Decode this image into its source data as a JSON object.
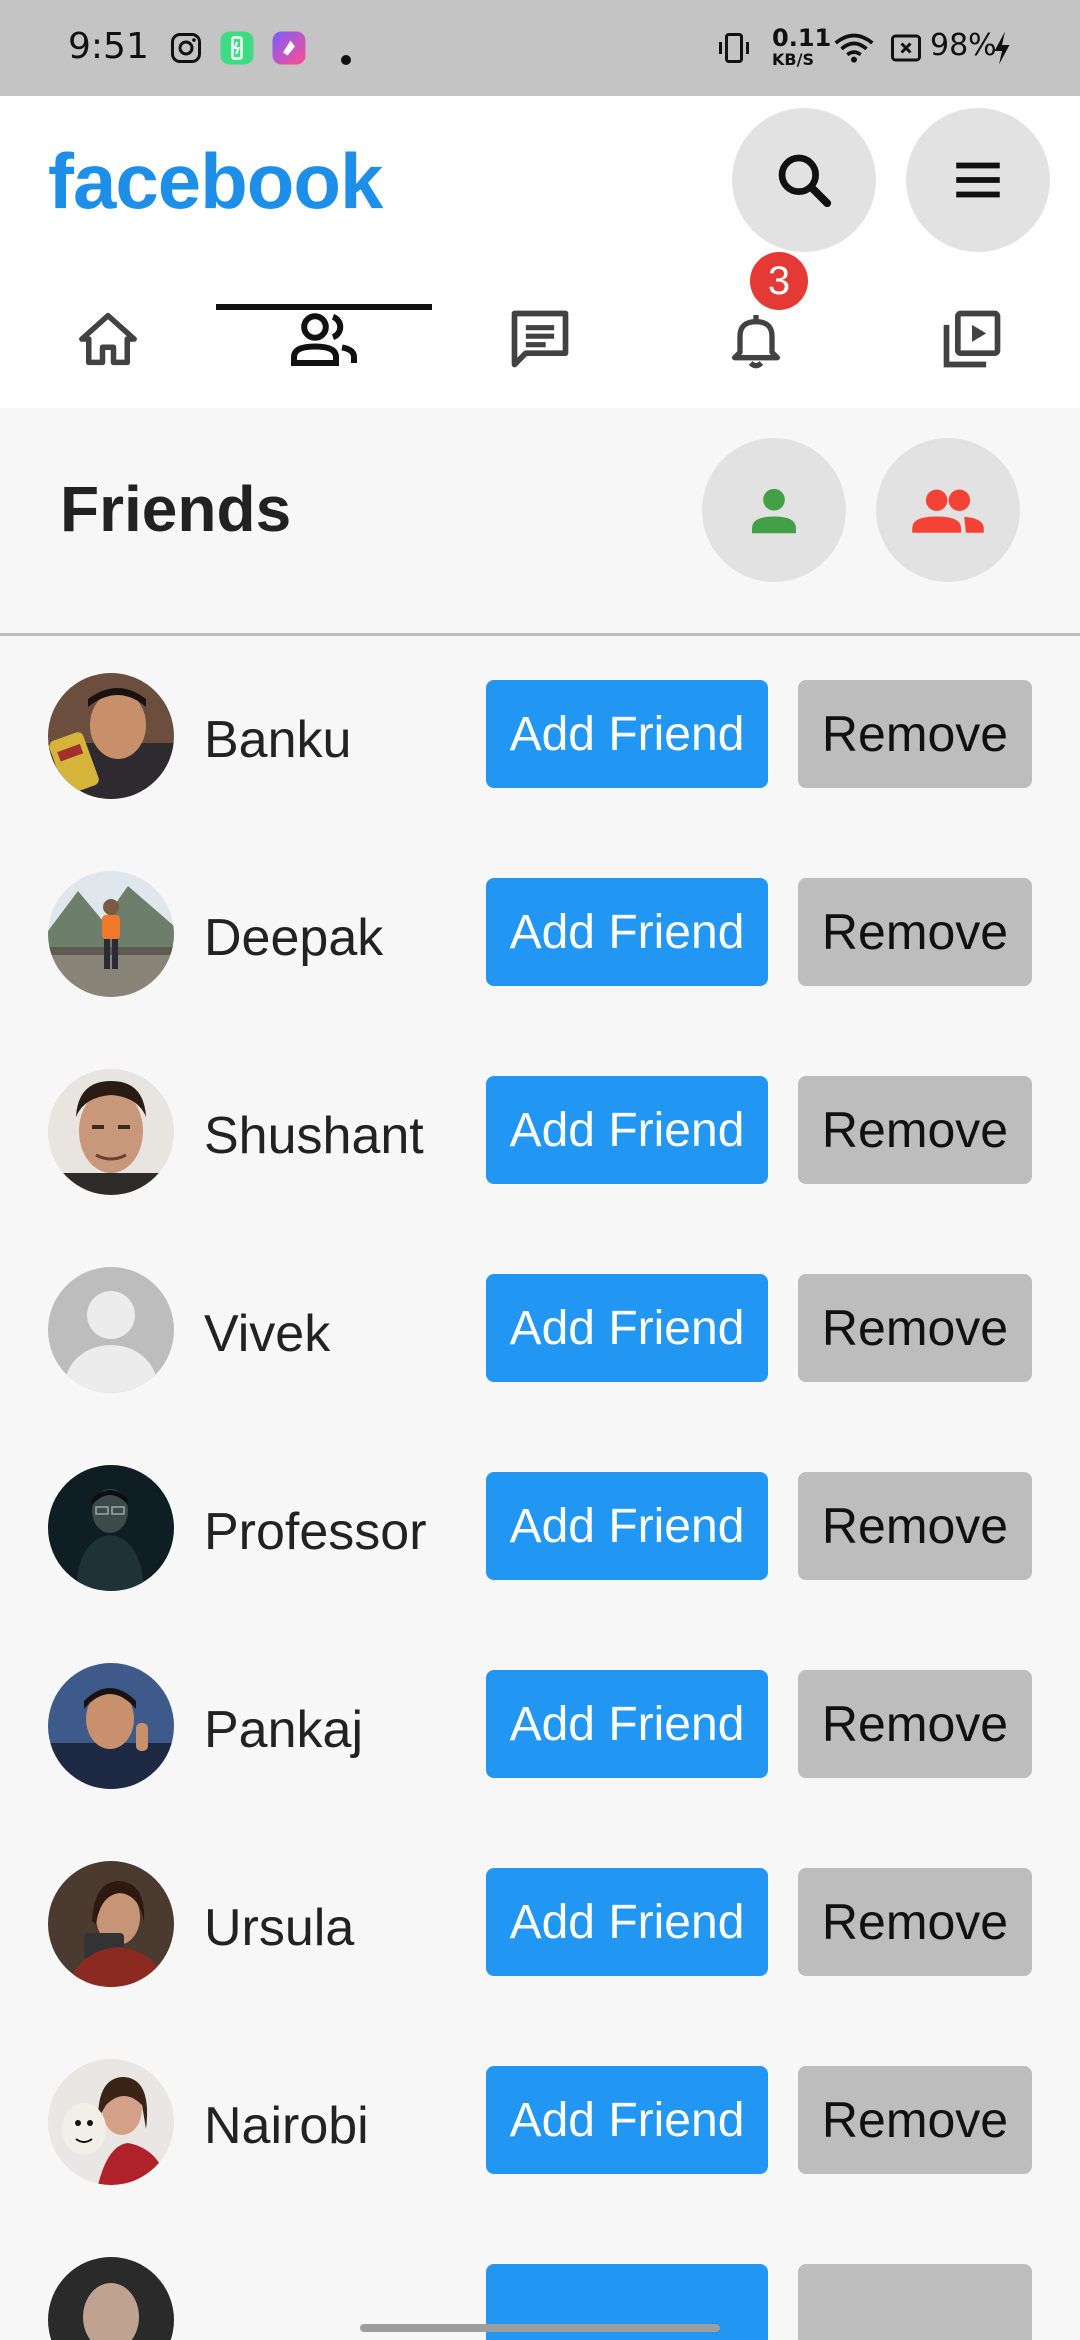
{
  "status_bar": {
    "time": "9:51",
    "speed_value": "0.11",
    "speed_unit": "KB/S",
    "battery": "98%",
    "icons": [
      "instagram-icon",
      "battery-saver-icon",
      "shortcut-icon",
      "dot-icon",
      "vibrate-icon",
      "wifi-icon",
      "sim-blocked-icon",
      "charging-icon"
    ]
  },
  "header": {
    "brand": "facebook",
    "brand_color": "#1e8fe8",
    "actions": [
      "search-icon",
      "menu-icon"
    ]
  },
  "tabs": [
    {
      "icon": "home-icon",
      "active": false
    },
    {
      "icon": "friends-icon",
      "active": true
    },
    {
      "icon": "messages-icon",
      "active": false
    },
    {
      "icon": "bell-icon",
      "active": false,
      "badge": "3"
    },
    {
      "icon": "video-icon",
      "active": false
    }
  ],
  "friends": {
    "title": "Friends",
    "actions": [
      {
        "icon": "person-icon",
        "color": "#43a047"
      },
      {
        "icon": "group-icon",
        "color": "#f44336"
      }
    ],
    "add_label": "Add Friend",
    "remove_label": "Remove",
    "add_color": "#2196f3",
    "remove_color": "#bdbdbd",
    "items": [
      {
        "name": "Banku",
        "avatar": "photo"
      },
      {
        "name": "Deepak",
        "avatar": "photo"
      },
      {
        "name": "Shushant",
        "avatar": "photo"
      },
      {
        "name": "Vivek",
        "avatar": "placeholder"
      },
      {
        "name": "Professor",
        "avatar": "photo"
      },
      {
        "name": "Pankaj",
        "avatar": "photo"
      },
      {
        "name": "Ursula",
        "avatar": "photo"
      },
      {
        "name": "Nairobi",
        "avatar": "photo"
      }
    ]
  }
}
